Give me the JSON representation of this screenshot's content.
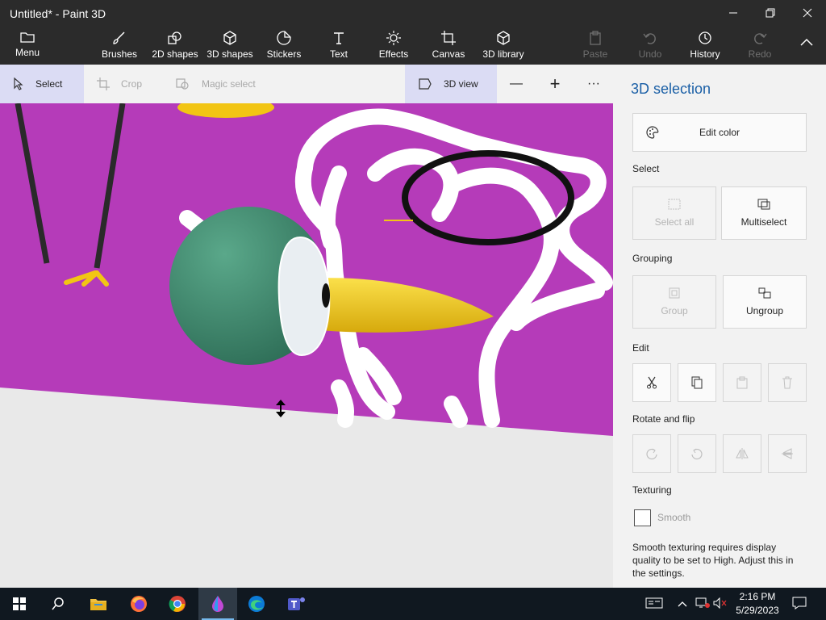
{
  "window": {
    "title": "Untitled* - Paint 3D"
  },
  "menubar": {
    "menu": "Menu",
    "tools": [
      "Brushes",
      "2D shapes",
      "3D shapes",
      "Stickers",
      "Text",
      "Effects",
      "Canvas",
      "3D library"
    ],
    "actions": [
      "Paste",
      "Undo",
      "History",
      "Redo"
    ]
  },
  "toolbar": {
    "select": "Select",
    "crop": "Crop",
    "magic_select": "Magic select",
    "view3d": "3D view",
    "zoom_out": "—",
    "zoom_in": "+",
    "more": "···"
  },
  "panel": {
    "title": "3D selection",
    "edit_color": "Edit color",
    "select_section": "Select",
    "select_all": "Select all",
    "multiselect": "Multiselect",
    "grouping_section": "Grouping",
    "group": "Group",
    "ungroup": "Ungroup",
    "edit_section": "Edit",
    "rotate_section": "Rotate and flip",
    "texturing_section": "Texturing",
    "smooth": "Smooth",
    "smooth_note": "Smooth texturing requires display quality to be set to High. Adjust this in the settings."
  },
  "taskbar": {
    "time": "2:16 PM",
    "date": "5/29/2023",
    "apps": [
      "start-icon",
      "search-icon",
      "file-explorer-icon",
      "firefox-icon",
      "chrome-icon",
      "paint-3d-icon",
      "edge-icon",
      "teams-icon"
    ]
  },
  "colors": {
    "canvas_magenta": "#b53bb9",
    "accent_blue": "#1a5fa6",
    "selection_lavender": "#dbdcf4",
    "beak_yellow": "#f5d11b",
    "head_green": "#3f8a6e"
  }
}
